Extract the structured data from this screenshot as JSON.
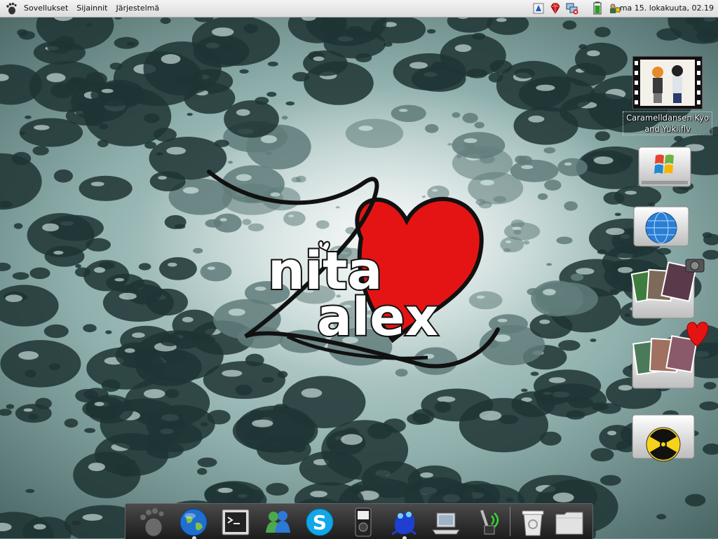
{
  "panel": {
    "menus": [
      {
        "label": "Sovellukset"
      },
      {
        "label": "Sijainnit"
      },
      {
        "label": "Järjestelmä"
      }
    ],
    "clock": "ma 15. lokakuuta, 02.19",
    "tray_icons": [
      "updates-icon",
      "ruby-gem-icon",
      "network-disconnected-icon",
      "battery-icon",
      "user-switch-icon"
    ]
  },
  "wallpaper": {
    "logo_top": "nita",
    "logo_bottom": "alex",
    "heart_color": "#e41414"
  },
  "desktop": {
    "video_file": {
      "label": "Caramelldansen Kyo and Yuki.flv"
    },
    "icons": [
      "windows-drive-icon",
      "network-drive-icon",
      "photos-camera-folder-icon",
      "photos-heart-folder-icon",
      "radioactive-drive-icon"
    ]
  },
  "dock": {
    "items": [
      "gnome-foot-icon",
      "web-browser-icon",
      "terminal-icon",
      "messenger-icon",
      "skype-icon",
      "media-player-icon",
      "compiz-frog-icon",
      "laptop-icon",
      "network-antenna-icon",
      "trash-icon",
      "folder-icon"
    ]
  }
}
